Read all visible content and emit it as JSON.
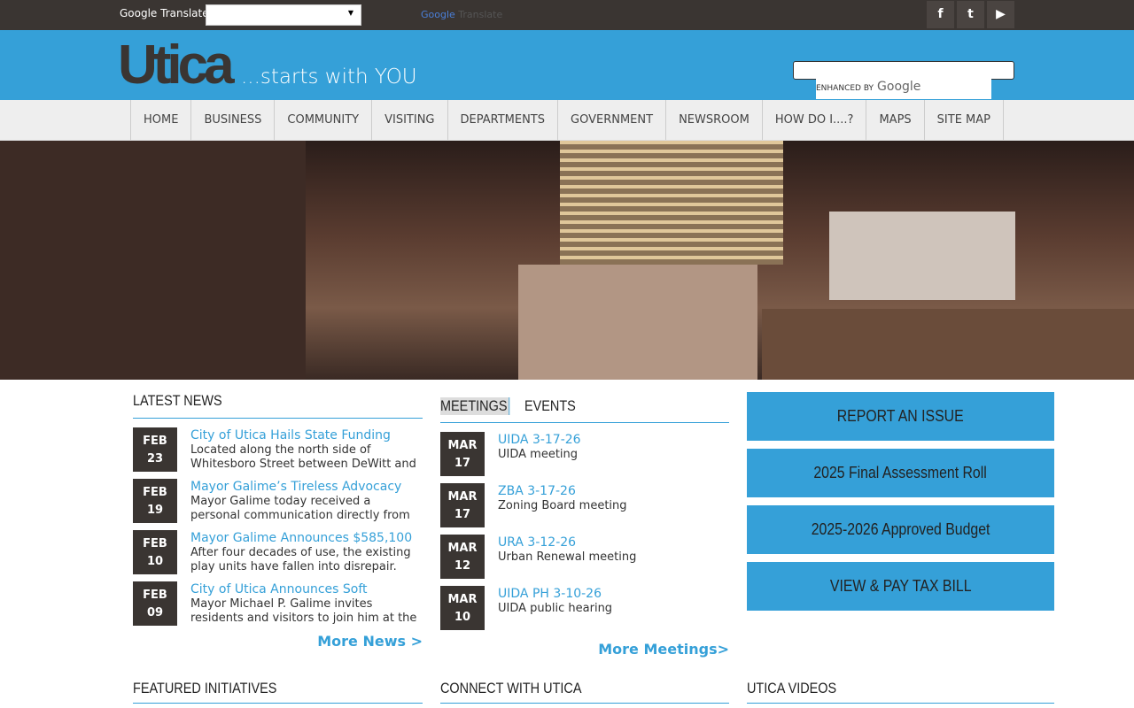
{
  "topbar": {
    "translate_label": "Google Translate",
    "translate_value": "",
    "translate_brand_google": "Google",
    "translate_brand_text": "Translate",
    "social": [
      {
        "icon": "facebook-icon",
        "glyph": "f"
      },
      {
        "icon": "twitter-icon",
        "glyph": "t"
      },
      {
        "icon": "youtube-icon",
        "glyph": "▶"
      }
    ]
  },
  "header": {
    "logo": "Utica",
    "tagline": "...starts with YOU",
    "search_value": "",
    "search_enhanced": "ENHANCED BY",
    "search_brand": "Google"
  },
  "nav": [
    "HOME",
    "BUSINESS",
    "COMMUNITY",
    "VISITING",
    "DEPARTMENTS",
    "GOVERNMENT",
    "NEWSROOM",
    "HOW DO I....?",
    "MAPS",
    "SITE MAP"
  ],
  "news": {
    "title": "LATEST NEWS",
    "more": "More News >",
    "items": [
      {
        "month": "FEB",
        "day": "23",
        "title": "City of Utica Hails State Funding",
        "text": "Located along the north side of Whitesboro Street between DeWitt and"
      },
      {
        "month": "FEB",
        "day": "19",
        "title": "Mayor Galime’s Tireless Advocacy",
        "text": "Mayor Galime today received a personal communication directly from"
      },
      {
        "month": "FEB",
        "day": "10",
        "title": "Mayor Galime Announces $585,100",
        "text": "After four decades of use, the existing play units have fallen into disrepair."
      },
      {
        "month": "FEB",
        "day": "09",
        "title": "City of Utica Announces Soft",
        "text": "Mayor Michael P. Galime invites residents and visitors to join him at the"
      }
    ]
  },
  "meetings": {
    "tab_meetings": "MEETINGS",
    "tab_events": "EVENTS",
    "more": "More Meetings>",
    "items": [
      {
        "month": "MAR",
        "day": "17",
        "title": "UIDA 3-17-26",
        "text": "UIDA meeting"
      },
      {
        "month": "MAR",
        "day": "17",
        "title": "ZBA 3-17-26",
        "text": "Zoning Board meeting"
      },
      {
        "month": "MAR",
        "day": "12",
        "title": "URA 3-12-26",
        "text": "Urban Renewal meeting"
      },
      {
        "month": "MAR",
        "day": "10",
        "title": "UIDA PH 3-10-26",
        "text": "UIDA public hearing"
      }
    ]
  },
  "buttons": [
    "REPORT AN ISSUE",
    "2025 Final Assessment Roll",
    "2025-2026 Approved Budget",
    "VIEW & PAY TAX BILL"
  ],
  "bottom": [
    "FEATURED INITIATIVES",
    "CONNECT WITH UTICA",
    "UTICA VIDEOS"
  ],
  "colors": {
    "accent": "#35a0d8",
    "dark": "#3a3532"
  }
}
